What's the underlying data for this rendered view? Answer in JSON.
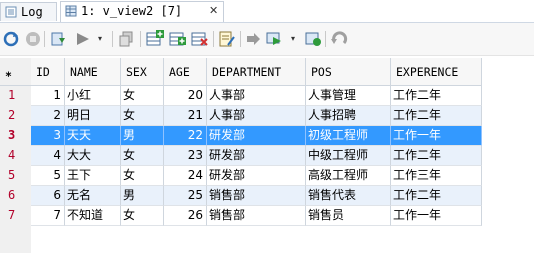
{
  "tabs": [
    {
      "label": "Log",
      "icon": "log-icon"
    },
    {
      "label": "1: v_view2 [7]",
      "icon": "grid-icon",
      "close": "✕"
    }
  ],
  "toolbar": {
    "icons": [
      "refresh-icon",
      "stop-icon",
      "import-icon",
      "query-icon",
      "copy-icon",
      "insert-row-icon",
      "duplicate-row-icon",
      "delete-row-icon",
      "edit-icon",
      "navigate-icon",
      "go-icon",
      "apply-icon",
      "undo-icon"
    ]
  },
  "grid": {
    "corner": "*",
    "columns": [
      "ID",
      "NAME",
      "SEX",
      "AGE",
      "DEPARTMENT",
      "POS",
      "EXPERENCE"
    ],
    "rows": [
      {
        "num": "1",
        "cells": [
          "1",
          "小红",
          "女",
          "20",
          "人事部",
          "人事管理",
          "工作二年"
        ]
      },
      {
        "num": "2",
        "cells": [
          "2",
          "明日",
          "女",
          "21",
          "人事部",
          "人事招聘",
          "工作二年"
        ]
      },
      {
        "num": "3",
        "cells": [
          "3",
          "天天",
          "男",
          "22",
          "研发部",
          "初级工程师",
          "工作一年"
        ]
      },
      {
        "num": "4",
        "cells": [
          "4",
          "大大",
          "女",
          "23",
          "研发部",
          "中级工程师",
          "工作二年"
        ]
      },
      {
        "num": "5",
        "cells": [
          "5",
          "王下",
          "女",
          "24",
          "研发部",
          "高级工程师",
          "工作三年"
        ]
      },
      {
        "num": "6",
        "cells": [
          "6",
          "无名",
          "男",
          "25",
          "销售部",
          "销售代表",
          "工作二年"
        ]
      },
      {
        "num": "7",
        "cells": [
          "7",
          "不知道",
          "女",
          "26",
          "销售部",
          "销售员",
          "工作一年"
        ]
      }
    ],
    "selected_row": 3
  },
  "colors": {
    "selection": "#3399ff",
    "alt_row": "#e9f1fb",
    "row_number": "#b2002a"
  }
}
